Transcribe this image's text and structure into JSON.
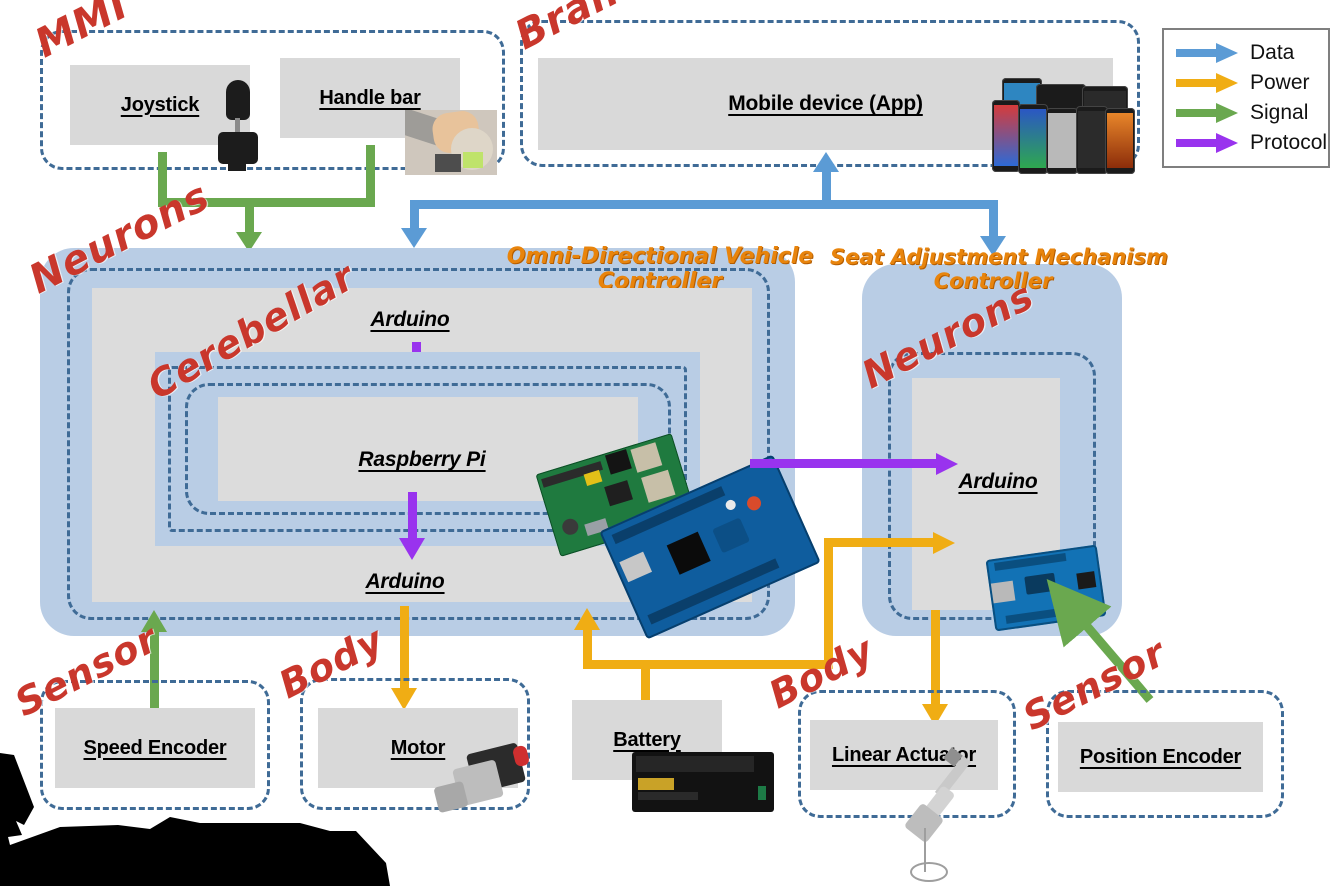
{
  "legend": {
    "title": "legend",
    "items": [
      {
        "label": "Data",
        "color": "#5b9bd5"
      },
      {
        "label": "Power",
        "color": "#f0ad14"
      },
      {
        "label": "Signal",
        "color": "#6aa84f"
      },
      {
        "label": "Protocol",
        "color": "#9933ee"
      }
    ]
  },
  "groups": {
    "mmi": {
      "tag": "MMI"
    },
    "brain": {
      "tag": "Brain"
    },
    "neurons_left": {
      "tag": "Neurons"
    },
    "cerebellar": {
      "tag": "Cerebellar"
    },
    "neurons_right": {
      "tag": "Neurons"
    },
    "sensor_left": {
      "tag": "Sensor"
    },
    "body_left": {
      "tag": "Body"
    },
    "body_right": {
      "tag": "Body"
    },
    "sensor_right": {
      "tag": "Sensor"
    }
  },
  "controllers": {
    "vehicle": {
      "line1": "Omni-Directional Vehicle",
      "line2": "Controller"
    },
    "seat": {
      "line1": "Seat Adjustment Mechanism",
      "line2": "Controller"
    }
  },
  "nodes": {
    "joystick": {
      "label": "Joystick"
    },
    "handle_bar": {
      "label": "Handle bar"
    },
    "mobile_device": {
      "label": "Mobile device (App)"
    },
    "arduino_top": {
      "label": "Arduino"
    },
    "raspberry_pi": {
      "label": "Raspberry Pi"
    },
    "arduino_bottom": {
      "label": "Arduino"
    },
    "arduino_seat": {
      "label": "Arduino"
    },
    "speed_encoder": {
      "label": "Speed Encoder"
    },
    "motor": {
      "label": "Motor"
    },
    "battery": {
      "label": "Battery"
    },
    "linear_actuator": {
      "label": "Linear Actuator"
    },
    "position_encoder": {
      "label": "Position Encoder"
    }
  },
  "colors": {
    "data": "#5b9bd5",
    "power": "#f0ad14",
    "signal": "#6aa84f",
    "protocol": "#9933ee",
    "frame": "#3f6b96",
    "panel": "#b9cde5",
    "box": "#d9d9d9",
    "tag": "#c9372c",
    "title": "#e8840c"
  },
  "connections": [
    {
      "from": "joystick",
      "to": "vehicle_controller",
      "type": "Signal"
    },
    {
      "from": "handle_bar",
      "to": "vehicle_controller",
      "type": "Signal"
    },
    {
      "from": "mobile_device",
      "to": "vehicle_controller",
      "type": "Data"
    },
    {
      "from": "mobile_device",
      "to": "seat_controller",
      "type": "Data"
    },
    {
      "from": "arduino_top",
      "to": "raspberry_pi",
      "type": "Protocol"
    },
    {
      "from": "raspberry_pi",
      "to": "arduino_bottom",
      "type": "Protocol"
    },
    {
      "from": "raspberry_pi",
      "to": "arduino_seat",
      "type": "Protocol"
    },
    {
      "from": "arduino_bottom",
      "to": "motor",
      "type": "Power"
    },
    {
      "from": "speed_encoder",
      "to": "arduino_bottom",
      "type": "Signal"
    },
    {
      "from": "battery",
      "to": "vehicle_controller",
      "type": "Power"
    },
    {
      "from": "battery",
      "to": "seat_controller",
      "type": "Power"
    },
    {
      "from": "arduino_seat",
      "to": "linear_actuator",
      "type": "Power"
    },
    {
      "from": "position_encoder",
      "to": "arduino_seat",
      "type": "Signal"
    }
  ]
}
